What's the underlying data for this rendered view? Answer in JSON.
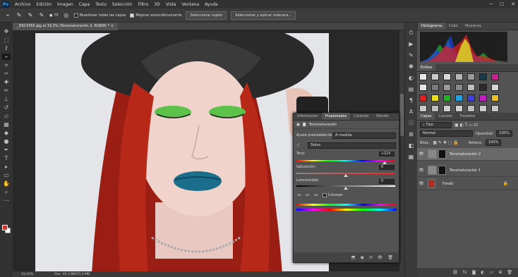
{
  "menubar": {
    "logo": "Ps",
    "items": [
      "Archivo",
      "Edición",
      "Imagen",
      "Capa",
      "Texto",
      "Selección",
      "Filtro",
      "3D",
      "Vista",
      "Ventana",
      "Ayuda"
    ]
  },
  "options": {
    "brush_size": "75",
    "sample_all_layers": "Muestrear todas las capas",
    "auto_enhance": "Mejorar automáticamente",
    "select_subject": "Seleccionar sujeto",
    "select_and_mask": "Seleccionar y aplicar máscara..."
  },
  "document": {
    "tab_title": "_DSC4355.jpg al 33,3% (Tono/saturación 2, RGB/8) *",
    "zoom": "33,33%",
    "doc_info": "Doc: 46,3 MB/51,0 MB"
  },
  "histogram": {
    "tabs": [
      "Histograma",
      "Color",
      "Muestras"
    ]
  },
  "styles": {
    "tab": "Estilos",
    "swatches": [
      "#e8e8e8",
      "#c9c9c9",
      "#dadada",
      "#b7b7b7",
      "#9a9a9a",
      "#1a3a4a",
      "#c8208c",
      "#e8e8e8",
      "#7a7a7a",
      "#9a9a9a",
      "#8a8a8a",
      "#c0c0c0",
      "#2a2a2a",
      "#d4d4d4",
      "#e02020",
      "#e8e020",
      "#20b020",
      "#20a0e0",
      "#4040e0",
      "#c020c0",
      "#e8c020",
      "#c8c8c8",
      "#bdbdbd",
      "#cfcfcf",
      "#cfcfcf",
      "#bbbbbb",
      "#cccccc",
      "#c8c8c8"
    ]
  },
  "layers": {
    "tabs": [
      "Capas",
      "Canales",
      "Trazados"
    ],
    "filter": "Tipo",
    "blend": "Normal",
    "opacity_label": "Opacidad:",
    "opacity": "100%",
    "lock_label": "Bloq.:",
    "fill_label": "Relleno:",
    "fill": "100%",
    "items": [
      {
        "name": "Tono/saturación 2"
      },
      {
        "name": "Tono/saturación 1"
      },
      {
        "name": "Fondo"
      }
    ]
  },
  "properties": {
    "tabs": [
      "Información",
      "Propiedades",
      "Carácter",
      "Párrafo"
    ],
    "title": "Tono/saturación",
    "preset_label": "Ajuste preestablecido:",
    "preset": "A medida",
    "channel": "Todos",
    "hue_label": "Tono:",
    "hue": "+114",
    "hue_level": 0.89,
    "saturation_label": "Saturación:",
    "saturation": "0",
    "saturation_level": 0.5,
    "lightness_label": "Luminosidad:",
    "lightness": "0",
    "lightness_level": 0.5,
    "colorize": "Colorear"
  }
}
